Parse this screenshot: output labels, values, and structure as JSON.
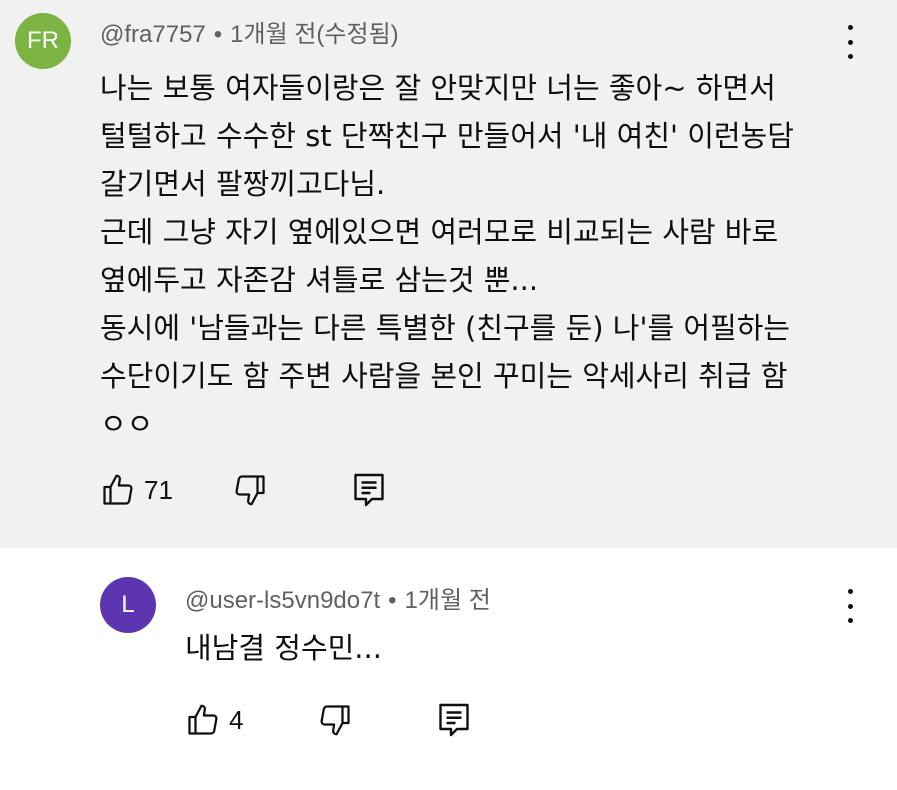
{
  "comments": [
    {
      "avatar_initials": "FR",
      "avatar_color": "#7cb342",
      "author": "@fra7757",
      "separator": "•",
      "time": "1개월 전(수정됨)",
      "lines": [
        "나는 보통 여자들이랑은 잘 안맞지만 너는 좋아~ 하면서",
        "털털하고 수수한 st 단짝친구 만들어서 '내 여친' 이런농담",
        "갈기면서 팔짱끼고다님.",
        "근데 그냥 자기 옆에있으면 여러모로 비교되는 사람 바로",
        "옆에두고 자존감 셔틀로 삼는것 뿐...",
        "동시에 '남들과는 다른 특별한 (친구를 둔) 나'를 어필하는",
        "수단이기도 함 주변 사람을 본인 꾸미는 악세사리 취급 함",
        "ㅇㅇ"
      ],
      "like_count": "71",
      "icons": {
        "like": "thumbs-up-icon",
        "dislike": "thumbs-down-icon",
        "reply": "reply-icon",
        "menu": "more-vert-icon"
      }
    },
    {
      "avatar_initials": "L",
      "avatar_color": "#5e35b1",
      "author": "@user-ls5vn9do7t",
      "separator": "•",
      "time": "1개월 전",
      "lines": [
        "내남결 정수민..."
      ],
      "like_count": "4",
      "icons": {
        "like": "thumbs-up-icon",
        "dislike": "thumbs-down-icon",
        "reply": "reply-icon",
        "menu": "more-vert-icon"
      }
    }
  ]
}
